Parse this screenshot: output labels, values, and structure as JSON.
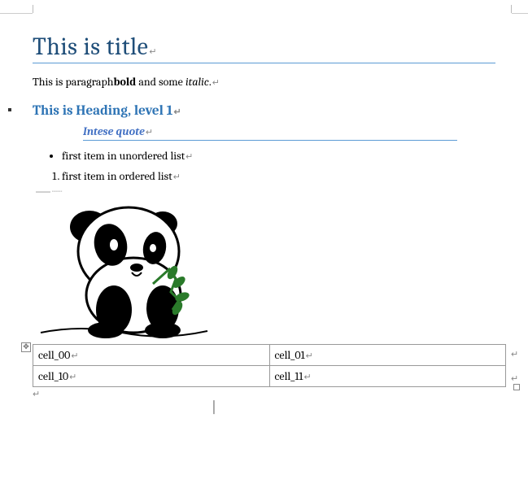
{
  "title": "This is title",
  "paragraph": {
    "part1": "This is paragraph",
    "bold": "bold",
    "part2": " and some ",
    "italic": "italic",
    "part3": "."
  },
  "heading1": "This is Heading, level 1",
  "quote": "Intese quote",
  "ul_item": "first item in unordered list",
  "ol_item": "first item in ordered list",
  "table": {
    "rows": [
      [
        "cell_00",
        "cell_01"
      ],
      [
        "cell_10",
        "cell_11"
      ]
    ]
  },
  "marks": {
    "pilcrow": "↵",
    "move": "✥",
    "resize": "□"
  }
}
